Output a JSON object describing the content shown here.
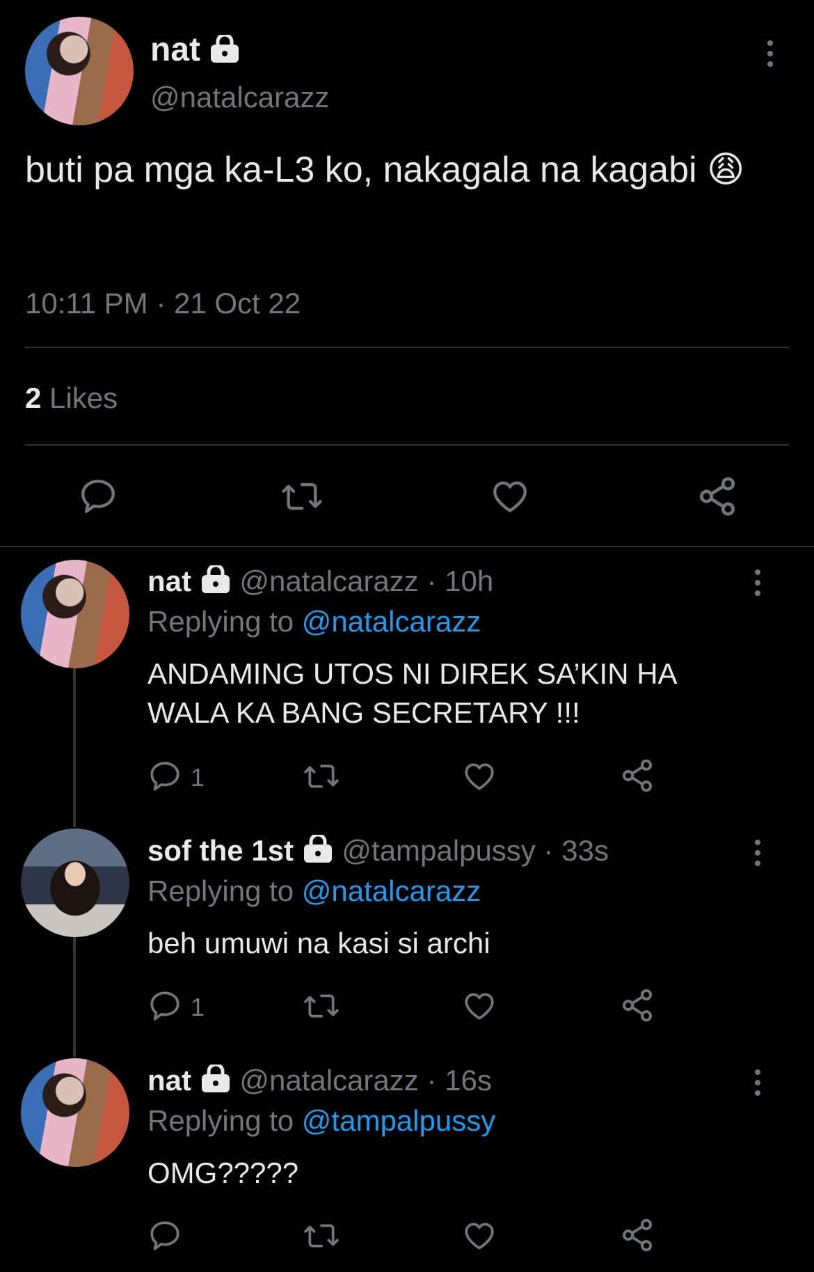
{
  "main_tweet": {
    "author_name": "nat",
    "author_handle": "@natalcarazz",
    "text": "buti pa mga ka-L3 ko, nakagala na kagabi 😩",
    "time": "10:11 PM",
    "date": "21 Oct 22",
    "timestamp_sep": "·",
    "likes_count": "2",
    "likes_label": "Likes"
  },
  "replies": [
    {
      "author_name": "nat",
      "author_handle": "@natalcarazz",
      "time_ago": "10h",
      "replying_label": "Replying to",
      "replying_to": "@natalcarazz",
      "text": "ANDAMING UTOS NI DIREK SA’KIN HA WALA KA BANG SECRETARY !!!",
      "reply_count": "1"
    },
    {
      "author_name": "sof the 1st",
      "author_handle": "@tampalpussy",
      "time_ago": "33s",
      "replying_label": "Replying to",
      "replying_to": "@natalcarazz",
      "text": "beh umuwi na kasi si archi",
      "reply_count": "1"
    },
    {
      "author_name": "nat",
      "author_handle": "@natalcarazz",
      "time_ago": "16s",
      "replying_label": "Replying to",
      "replying_to": "@tampalpussy",
      "text": "OMG?????",
      "reply_count": ""
    }
  ],
  "colors": {
    "background": "#000000",
    "text": "#e7e9ea",
    "secondary": "#71767b",
    "link": "#1d9bf0",
    "divider": "#2f3336"
  },
  "icons": {
    "lock": "lock-icon",
    "more": "more-dots-icon",
    "reply": "reply-bubble-icon",
    "retweet": "retweet-icon",
    "like": "heart-icon",
    "share": "share-icon"
  }
}
